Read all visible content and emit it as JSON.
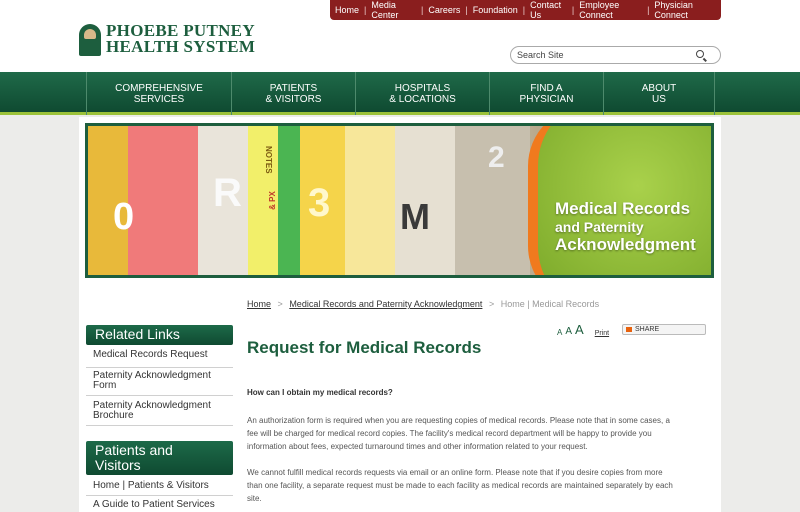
{
  "topbar": {
    "links": [
      "Home",
      "Media Center",
      "Careers",
      "Foundation",
      "Contact Us",
      "Employee Connect",
      "Physician Connect"
    ]
  },
  "logo": {
    "line1": "PHOEBE PUTNEY",
    "line2": "HEALTH SYSTEM"
  },
  "search": {
    "placeholder": "Search Site"
  },
  "nav": {
    "items": [
      {
        "line1": "COMPREHENSIVE",
        "line2": "SERVICES"
      },
      {
        "line1": "PATIENTS",
        "line2": "& VISITORS"
      },
      {
        "line1": "HOSPITALS",
        "line2": "& LOCATIONS"
      },
      {
        "line1": "FIND A",
        "line2": "PHYSICIAN"
      },
      {
        "line1": "ABOUT",
        "line2": "US"
      }
    ]
  },
  "banner": {
    "line1": "Medical Records",
    "line2": "and Paternity",
    "line3": "Acknowledgment",
    "glyphs": [
      "0",
      "R",
      "3",
      "M",
      "2",
      "NOTES",
      "& PX"
    ]
  },
  "breadcrumb": {
    "home": "Home",
    "parent": "Medical Records and Paternity Acknowledgment",
    "current": "Home | Medical Records",
    "separator": ">"
  },
  "sidebar": {
    "related_title": "Related Links",
    "related_items": [
      "Medical Records Request",
      "Paternity Acknowledgment Form",
      "Paternity Acknowledgment Brochure"
    ],
    "patients_title": "Patients and Visitors",
    "patients_items": [
      "Home | Patients & Visitors",
      "A Guide to Patient Services"
    ]
  },
  "tools": {
    "font_small": "A",
    "font_medium": "A",
    "font_large": "A",
    "print": "Print",
    "share": "SHARE"
  },
  "content": {
    "title": "Request for Medical Records",
    "question": "How can I obtain my medical records?",
    "para1": "An authorization form is required when you are requesting copies of medical records. Please note that in some cases, a fee will be charged for medical record copies. The facility's medical record department will be happy to provide you information about fees, expected turnaround times and other information related to your request.",
    "para2": "We cannot fulfill medical records requests via email or an online form. Please note that if you desire copies from more than one facility, a separate request must be made to each facility as medical records are maintained separately by each site."
  },
  "colors": {
    "brand_green": "#1d5e3e",
    "topbar_red": "#8a1e1e",
    "accent_lime": "#9cc23a"
  }
}
